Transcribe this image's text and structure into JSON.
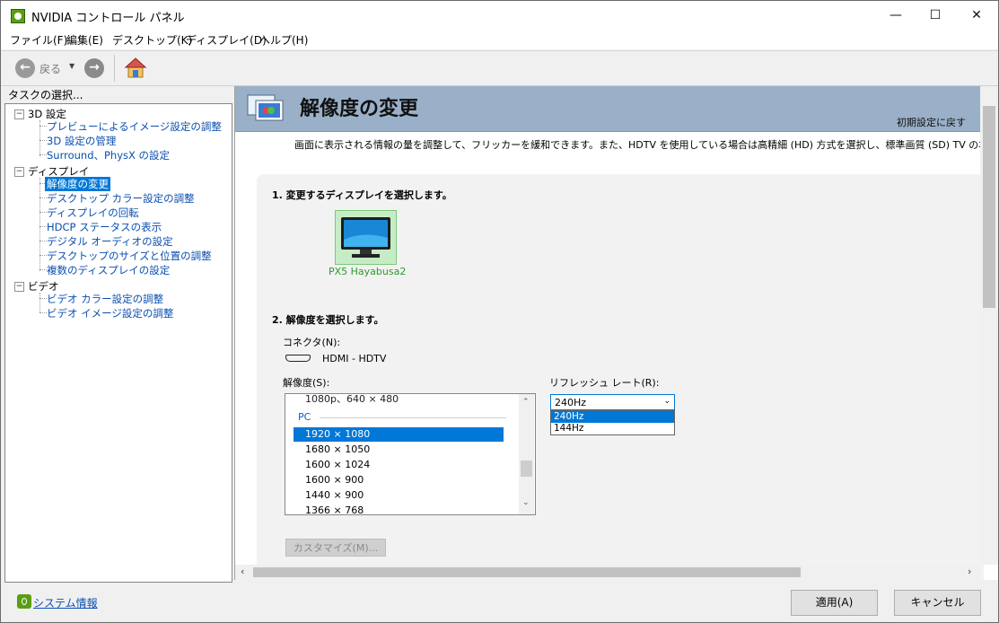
{
  "window": {
    "title": "NVIDIA コントロール パネル",
    "controls": {
      "minimize": "—",
      "maximize": "☐",
      "close": "✕"
    }
  },
  "menubar": [
    "ファイル(F)",
    "編集(E)",
    "デスクトップ(K)",
    "ディスプレイ(D)",
    "ヘルプ(H)"
  ],
  "toolbar": {
    "back_label": "戻る",
    "back_icon": "back-arrow-icon",
    "forward_icon": "forward-arrow-icon",
    "home_icon": "home-icon"
  },
  "sidebar": {
    "label": "タスクの選択...",
    "categories": [
      {
        "label": "3D 設定",
        "items": [
          "プレビューによるイメージ設定の調整",
          "3D 設定の管理",
          "Surround、PhysX の設定"
        ]
      },
      {
        "label": "ディスプレイ",
        "items": [
          "解像度の変更",
          "デスクトップ カラー設定の調整",
          "ディスプレイの回転",
          "HDCP ステータスの表示",
          "デジタル オーディオの設定",
          "デスクトップのサイズと位置の調整",
          "複数のディスプレイの設定"
        ]
      },
      {
        "label": "ビデオ",
        "items": [
          "ビデオ カラー設定の調整",
          "ビデオ イメージ設定の調整"
        ]
      }
    ],
    "selected": "解像度の変更"
  },
  "main": {
    "title": "解像度の変更",
    "restore_defaults": "初期設定に戻す",
    "description": "画面に表示される情報の量を調整して、フリッカーを緩和できます。また、HDTV を使用している場合は高精細 (HD) 方式を選択し、標準画質 (SD) TV の場合は",
    "section1_heading": "1. 変更するディスプレイを選択します。",
    "display_name": "PX5 Hayabusa2",
    "section2_heading": "2. 解像度を選択します。",
    "connector_label": "コネクタ(N):",
    "connector_value": "HDMI - HDTV",
    "resolution_label": "解像度(S):",
    "refresh_label": "リフレッシュ レート(R):",
    "resolution_list": {
      "cut_item": "1080p、640 × 480",
      "group": "PC",
      "items": [
        "1920 × 1080",
        "1680 × 1050",
        "1600 × 1024",
        "1600 × 900",
        "1440 × 900",
        "1366 × 768"
      ],
      "selected": "1920 × 1080"
    },
    "refresh_rate": {
      "value": "240Hz",
      "options": [
        "240Hz",
        "144Hz"
      ],
      "highlighted": "240Hz"
    },
    "customize_button": "カスタマイズ(M)..."
  },
  "footer": {
    "system_info": "システム情報",
    "apply_button": "適用(A)",
    "cancel_button": "キャンセル"
  },
  "colors": {
    "selection": "#0078d7",
    "banner": "#9ab0c8",
    "link": "#0b4fb0",
    "nvidia_green": "#5a9e14"
  }
}
